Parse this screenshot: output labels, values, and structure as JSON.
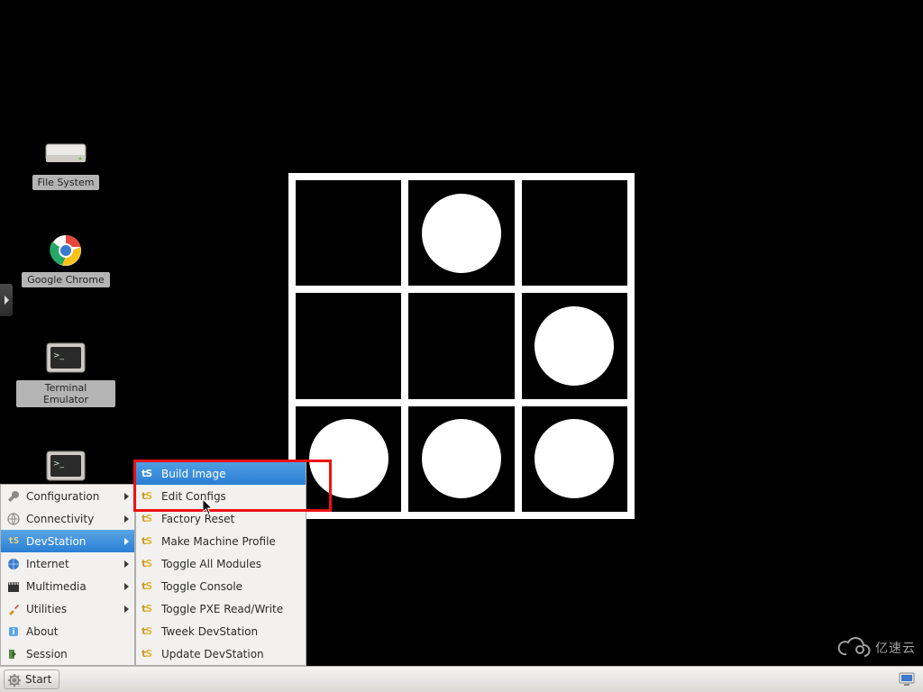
{
  "desktop": {
    "icons": [
      {
        "label": "File System"
      },
      {
        "label": "Google Chrome"
      },
      {
        "label": "Terminal Emulator"
      }
    ]
  },
  "start_menu": {
    "button_label": "Start",
    "items": [
      {
        "label": "Configuration",
        "has_sub": true
      },
      {
        "label": "Connectivity",
        "has_sub": true
      },
      {
        "label": "DevStation",
        "has_sub": true,
        "active": true
      },
      {
        "label": "Internet",
        "has_sub": true
      },
      {
        "label": "Multimedia",
        "has_sub": true
      },
      {
        "label": "Utilities",
        "has_sub": true
      },
      {
        "label": "About"
      },
      {
        "label": "Session"
      }
    ],
    "submenu": {
      "parent": "DevStation",
      "items": [
        {
          "label": "Build Image",
          "highlighted": true
        },
        {
          "label": "Edit Configs"
        },
        {
          "label": "Factory Reset"
        },
        {
          "label": "Make Machine Profile"
        },
        {
          "label": "Toggle All Modules"
        },
        {
          "label": "Toggle Console"
        },
        {
          "label": "Toggle PXE Read/Write"
        },
        {
          "label": "Tweek DevStation"
        },
        {
          "label": "Update DevStation"
        }
      ]
    }
  },
  "annotation": {
    "rect_purpose": "highlight-build-image-menuitem"
  },
  "watermark": {
    "text": "亿速云"
  },
  "colors": {
    "menu_highlight": "#2a7fd4",
    "annotation_red": "#e11"
  },
  "logo": {
    "pattern": [
      [
        0,
        1,
        0
      ],
      [
        0,
        0,
        1
      ],
      [
        1,
        1,
        1
      ]
    ]
  }
}
